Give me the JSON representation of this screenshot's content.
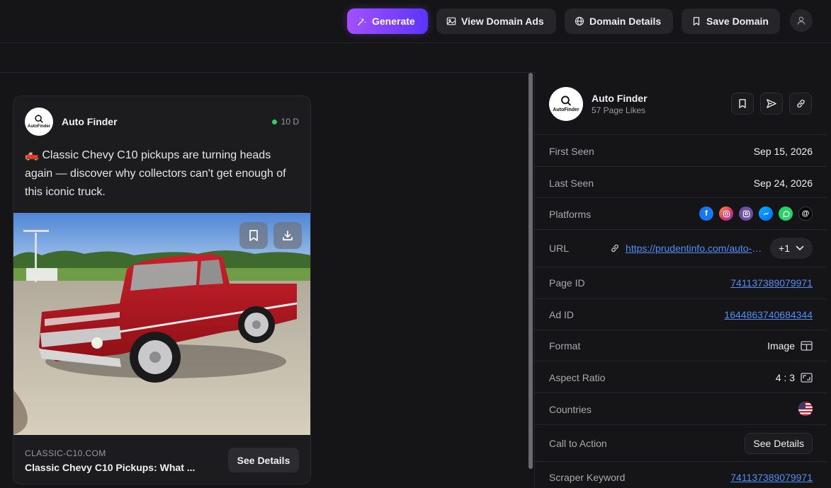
{
  "topbar": {
    "generate_label": "Generate",
    "view_ads_label": "View Domain Ads",
    "domain_details_label": "Domain Details",
    "save_domain_label": "Save Domain"
  },
  "ad_card": {
    "brand_name": "Auto Finder",
    "logo_text": "AutoFinder",
    "age": "10 D",
    "status_color": "#2fd16a",
    "emoji": "🛻",
    "body_text": "Classic Chevy C10 pickups are turning heads again — discover why collectors can't get enough of this iconic truck.",
    "domain": "CLASSIC-C10.COM",
    "headline": "Classic Chevy C10 Pickups: What ...",
    "cta_label": "See Details"
  },
  "panel": {
    "brand_name": "Auto Finder",
    "logo_text": "AutoFinder",
    "likes": "57 Page Likes",
    "rows": {
      "first_seen": {
        "label": "First Seen",
        "value": "Sep 15, 2026"
      },
      "last_seen": {
        "label": "Last Seen",
        "value": "Sep 24, 2026"
      },
      "platforms": {
        "label": "Platforms",
        "items": [
          "facebook-icon",
          "instagram-icon",
          "audience-network-icon",
          "messenger-icon",
          "whatsapp-icon",
          "threads-icon"
        ]
      },
      "url": {
        "label": "URL",
        "value": "https://prudentinfo.com/auto-finder",
        "more": "+1"
      },
      "page_id": {
        "label": "Page ID",
        "value": "741137389079971"
      },
      "ad_id": {
        "label": "Ad ID",
        "value": "1644863740684344"
      },
      "format": {
        "label": "Format",
        "value": "Image"
      },
      "aspect_ratio": {
        "label": "Aspect Ratio",
        "value": "4 : 3"
      },
      "countries": {
        "label": "Countries",
        "flag": "us-flag-icon"
      },
      "cta": {
        "label": "Call to Action",
        "value": "See Details"
      },
      "scraper_keyword": {
        "label": "Scraper Keyword",
        "value": "741137389079971"
      }
    }
  },
  "colors": {
    "accent_gradient_start": "#a250ff",
    "accent_gradient_end": "#5a34ff",
    "link": "#4f8ff7",
    "background": "#151517"
  }
}
